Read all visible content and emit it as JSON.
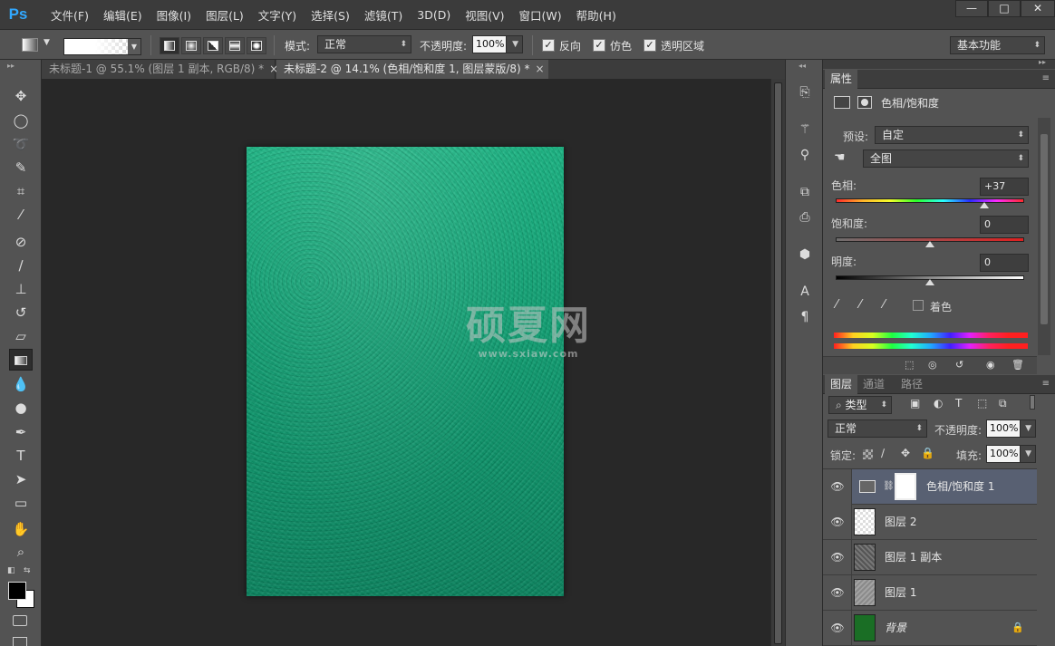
{
  "app": {
    "logo": "Ps",
    "menu": [
      "文件(F)",
      "编辑(E)",
      "图像(I)",
      "图层(L)",
      "文字(Y)",
      "选择(S)",
      "滤镜(T)",
      "3D(D)",
      "视图(V)",
      "窗口(W)",
      "帮助(H)"
    ],
    "window_buttons": {
      "minimize": "—",
      "maximize": "□",
      "close": "✕"
    }
  },
  "options": {
    "mode_label": "模式:",
    "mode_value": "正常",
    "opacity_label": "不透明度:",
    "opacity_value": "100%",
    "reverse_label": "反向",
    "dither_label": "仿色",
    "transparency_label": "透明区域",
    "workspace": "基本功能",
    "reverse_checked": true,
    "dither_checked": true,
    "transparency_checked": true
  },
  "tabs": [
    {
      "label": "未标题-1 @ 55.1% (图层 1 副本, RGB/8) *",
      "close": "×"
    },
    {
      "label": "未标题-2 @ 14.1% (色相/饱和度 1, 图层蒙版/8) *",
      "close": "×"
    }
  ],
  "canvas": {
    "watermark_main": "硕夏网",
    "watermark_url": "www.sxiaw.com"
  },
  "properties": {
    "panel_title": "属性",
    "adjustment_name": "色相/饱和度",
    "preset_label": "预设:",
    "preset_value": "自定",
    "channel_value": "全图",
    "hue_label": "色相:",
    "hue_value": "+37",
    "saturation_label": "饱和度:",
    "saturation_value": "0",
    "lightness_label": "明度:",
    "lightness_value": "0",
    "colorize_label": "着色",
    "hue_slider_position": 0.79,
    "saturation_slider_position": 0.5,
    "lightness_slider_position": 0.5
  },
  "layers_panel": {
    "tabs": [
      "图层",
      "通道",
      "路径"
    ],
    "filter_label": "类型",
    "blend_mode": "正常",
    "opacity_label": "不透明度:",
    "opacity_value": "100%",
    "lock_label": "锁定:",
    "fill_label": "填充:",
    "fill_value": "100%",
    "layers": [
      {
        "name": "色相/饱和度 1",
        "selected": true
      },
      {
        "name": "图层 2",
        "selected": false
      },
      {
        "name": "图层 1 副本",
        "selected": false
      },
      {
        "name": "图层 1",
        "selected": false
      },
      {
        "name": "背景",
        "selected": false
      }
    ]
  },
  "colors": {
    "canvas_green": "#14a779",
    "background_layer_green": "#1a6e25",
    "selected_layer": "#586072"
  }
}
